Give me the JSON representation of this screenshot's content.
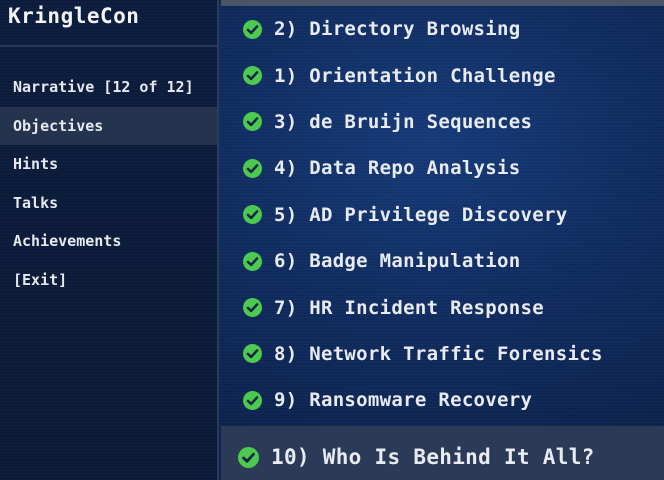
{
  "app": {
    "title": "KringleCon"
  },
  "sidebar": {
    "items": [
      {
        "label": "Narrative [12 of 12]",
        "active": false
      },
      {
        "label": "Objectives",
        "active": true
      },
      {
        "label": "Hints",
        "active": false
      },
      {
        "label": "Talks",
        "active": false
      },
      {
        "label": "Achievements",
        "active": false
      },
      {
        "label": "[Exit]",
        "active": false
      }
    ]
  },
  "objectives": {
    "items": [
      {
        "label": "2) Directory Browsing",
        "icon": "check-circle-icon",
        "completed": true
      },
      {
        "label": "1) Orientation Challenge",
        "icon": "check-circle-icon",
        "completed": true
      },
      {
        "label": "3) de Bruijn Sequences",
        "icon": "check-circle-icon",
        "completed": true
      },
      {
        "label": "4) Data Repo Analysis",
        "icon": "check-circle-icon",
        "completed": true
      },
      {
        "label": "5) AD Privilege Discovery",
        "icon": "check-circle-icon",
        "completed": true
      },
      {
        "label": "6) Badge Manipulation",
        "icon": "check-circle-icon",
        "completed": true
      },
      {
        "label": "7) HR Incident Response",
        "icon": "check-circle-icon",
        "completed": true
      },
      {
        "label": "8) Network Traffic Forensics",
        "icon": "check-circle-icon",
        "completed": true
      },
      {
        "label": "9) Ransomware Recovery",
        "icon": "check-circle-icon",
        "completed": true
      },
      {
        "label": "10) Who Is Behind It All?",
        "icon": "check-circle-icon",
        "completed": true,
        "highlighted": true
      }
    ]
  },
  "colors": {
    "check_green": "#4cc94f",
    "text": "#e8ebf2",
    "active_item_bg": "#24344f",
    "highlight_bg": "#2b3a57",
    "background": "#0f2a5c"
  }
}
